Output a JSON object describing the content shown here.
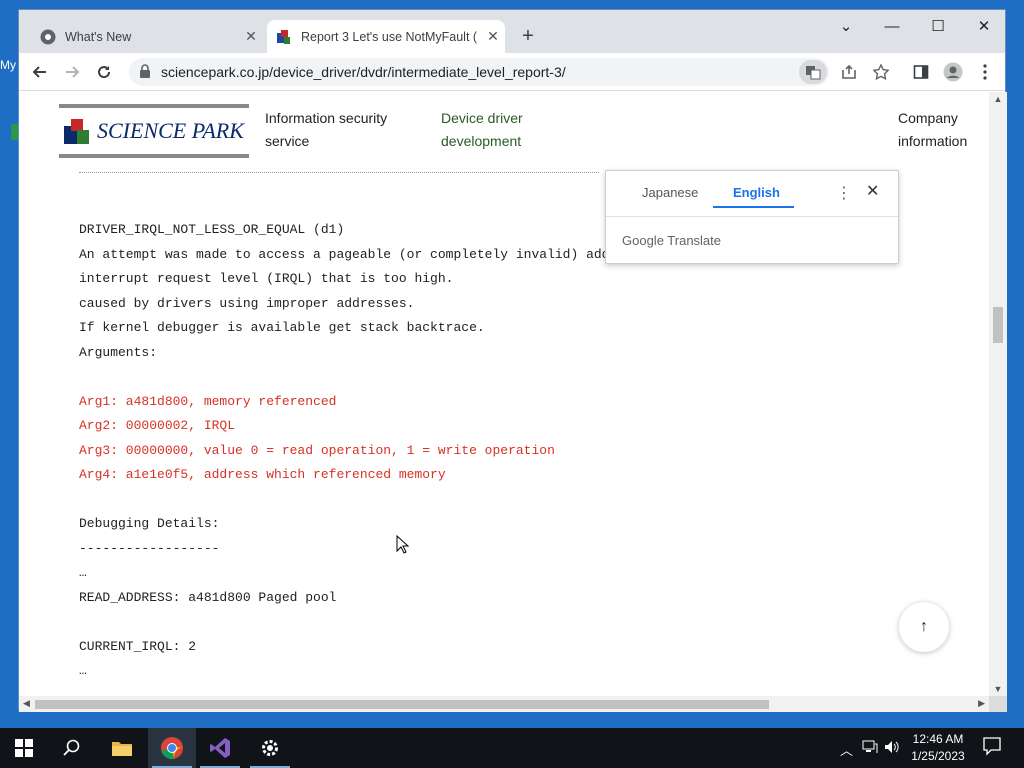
{
  "desktop": {
    "fragment_text": "My"
  },
  "browser": {
    "tabs": [
      {
        "title": "What's New",
        "icon": "chrome-icon"
      },
      {
        "title": "Report 3 Let's use NotMyFault (",
        "icon": "sciencepark-favicon"
      }
    ],
    "window_controls": {
      "minimize": "—",
      "maximize": "☐",
      "close": "✕",
      "tab_search": "⌄"
    },
    "url": "sciencepark.co.jp/device_driver/dvdr/intermediate_level_report-3/"
  },
  "site": {
    "logo_text": "SCIENCE PARK",
    "nav": [
      {
        "label_line1": "Information security",
        "label_line2": "service"
      },
      {
        "label_line1": "Device driver",
        "label_line2": "development"
      },
      {
        "label_line1": "Company",
        "label_line2": "information"
      }
    ]
  },
  "translate_popup": {
    "languages": [
      "Japanese",
      "English"
    ],
    "active": "English",
    "brand": "Google Translate"
  },
  "content": {
    "lines": [
      {
        "text": "DRIVER_IRQL_NOT_LESS_OR_EQUAL (d1)",
        "color": "normal"
      },
      {
        "text": "An attempt was made to access a pageable (or completely invalid) address at an",
        "color": "normal"
      },
      {
        "text": "interrupt request level (IRQL) that is too high.",
        "color": "normal"
      },
      {
        "text": "caused by drivers using improper addresses.",
        "color": "normal"
      },
      {
        "text": "If kernel debugger is available get stack backtrace.",
        "color": "normal"
      },
      {
        "text": "Arguments:",
        "color": "normal"
      },
      {
        "text": "",
        "color": "normal"
      },
      {
        "text": "Arg1: a481d800, memory referenced",
        "color": "red"
      },
      {
        "text": "Arg2: 00000002, IRQL",
        "color": "red"
      },
      {
        "text": "Arg3: 00000000, value 0 = read operation, 1 = write operation",
        "color": "red"
      },
      {
        "text": "Arg4: a1e1e0f5, address which referenced memory",
        "color": "red"
      },
      {
        "text": "",
        "color": "normal"
      },
      {
        "text": "Debugging Details:",
        "color": "normal"
      },
      {
        "text": "------------------",
        "color": "normal"
      },
      {
        "text": "…",
        "color": "normal"
      },
      {
        "text": "READ_ADDRESS: a481d800 Paged pool",
        "color": "normal"
      },
      {
        "text": "",
        "color": "normal"
      },
      {
        "text": "CURRENT_IRQL: 2",
        "color": "normal"
      },
      {
        "text": "…",
        "color": "normal"
      }
    ],
    "scroll_top_label": "↑"
  },
  "taskbar": {
    "clock_time": "12:46 AM",
    "clock_date": "1/25/2023",
    "pinned": [
      "start-icon",
      "search-icon",
      "file-explorer-icon",
      "chrome-icon",
      "visual-studio-icon",
      "settings-icon"
    ]
  },
  "colors": {
    "accent": "#1a73e8",
    "code_red": "#d93025",
    "nav_green": "#2a5a25",
    "taskbar": "#101418"
  }
}
